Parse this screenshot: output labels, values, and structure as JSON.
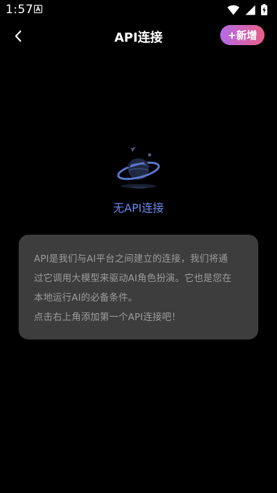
{
  "status_bar": {
    "time": "1:57",
    "notification_icon": "a-letter-icon",
    "icons": [
      "wifi-icon",
      "cellular-signal-icon",
      "battery-charging-icon"
    ]
  },
  "header": {
    "back_icon": "chevron-left-icon",
    "title": "API连接",
    "add_button_label": "+新增"
  },
  "empty_state": {
    "illustration": "planet-icon",
    "text": "无API连接"
  },
  "info_card": {
    "lines": [
      "API是我们与AI平台之间建立的连接，我们将通",
      "过它调用大模型来驱动AI角色扮演。它也是您在",
      "本地运行AI的必备条件。",
      "点击右上角添加第一个API连接吧！"
    ]
  },
  "colors": {
    "background": "#000000",
    "accent_text": "#6a8cf0",
    "card_background": "#3d3d3d",
    "card_text": "#9c9c9c",
    "button_gradient_start": "#b46be8",
    "button_gradient_end": "#e85f86"
  }
}
